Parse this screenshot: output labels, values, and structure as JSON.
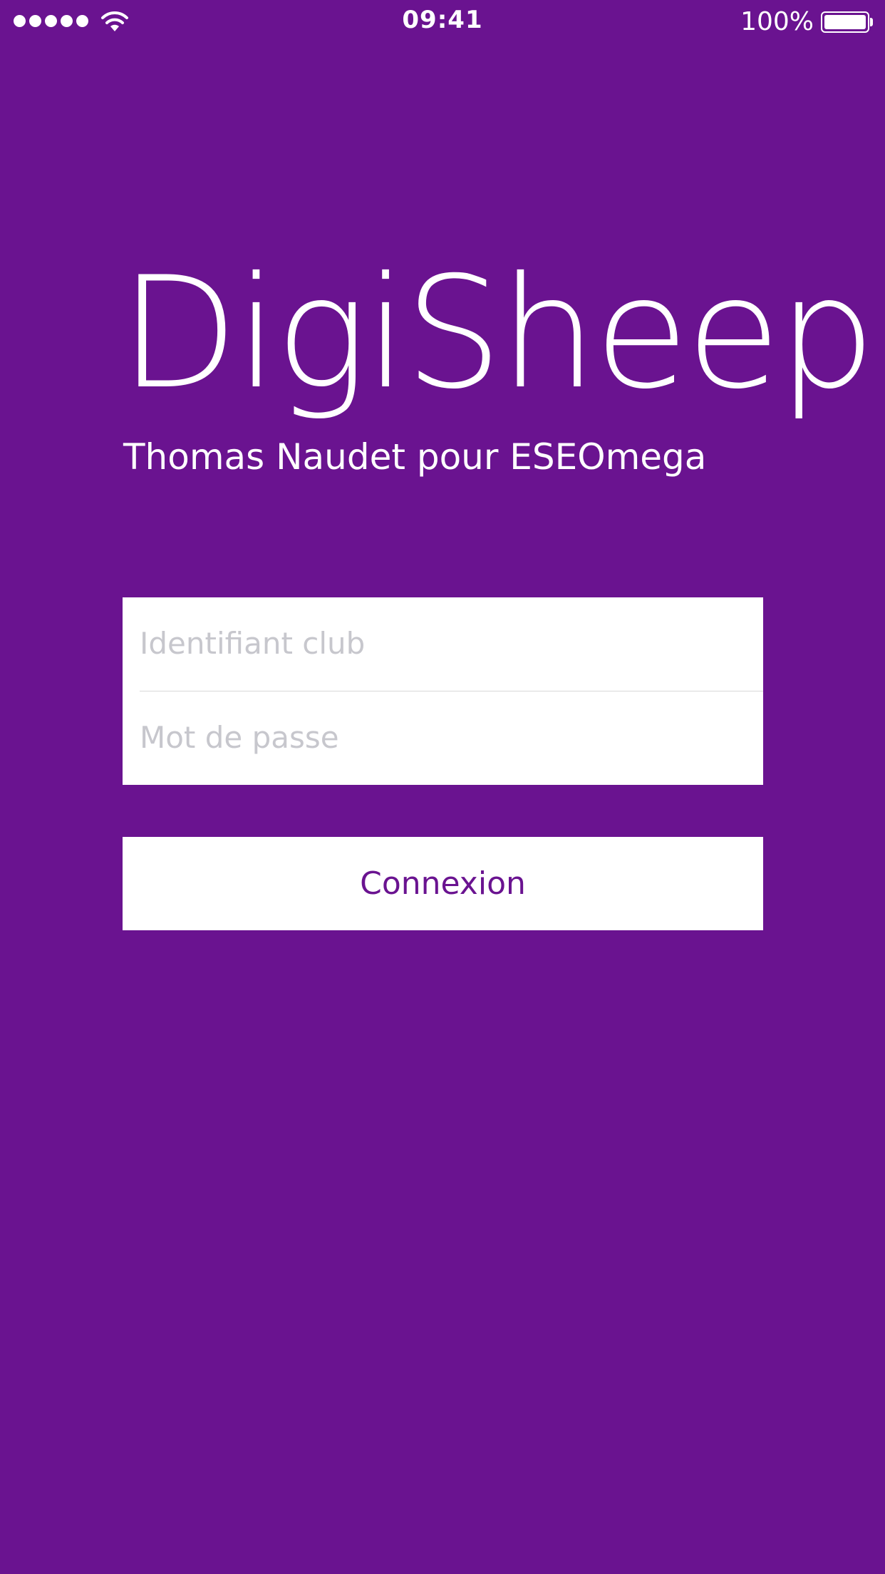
{
  "status_bar": {
    "time": "09:41",
    "battery_percent": "100%",
    "signal_bars": 5,
    "battery_level": 1.0
  },
  "colors": {
    "background": "#6a1390",
    "accent": "#6a1390",
    "card": "#ffffff",
    "placeholder": "#c7c7cd"
  },
  "header": {
    "title": "DigiSheep",
    "subtitle": "Thomas Naudet pour ESEOmega"
  },
  "login_form": {
    "username": {
      "value": "",
      "placeholder": "Identifiant club"
    },
    "password": {
      "value": "",
      "placeholder": "Mot de passe"
    },
    "submit_label": "Connexion"
  },
  "icons": {
    "signal": "signal-dots-icon",
    "wifi": "wifi-icon",
    "battery": "battery-icon"
  }
}
